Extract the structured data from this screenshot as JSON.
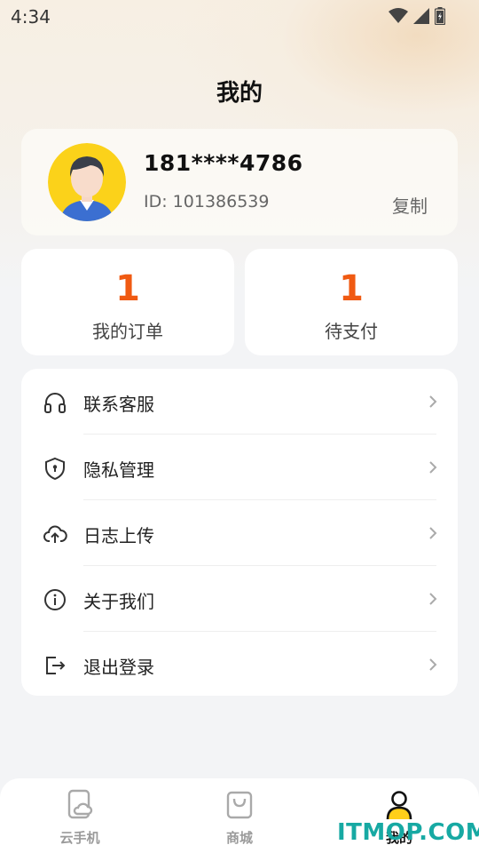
{
  "status_bar": {
    "time": "4:34"
  },
  "page": {
    "title": "我的"
  },
  "profile": {
    "phone": "181****4786",
    "id_text": "ID: 101386539",
    "copy_label": "复制"
  },
  "stats": [
    {
      "value": "1",
      "label": "我的订单"
    },
    {
      "value": "1",
      "label": "待支付"
    }
  ],
  "menu": [
    {
      "icon": "headset-icon",
      "label": "联系客服"
    },
    {
      "icon": "shield-icon",
      "label": "隐私管理"
    },
    {
      "icon": "cloud-upload-icon",
      "label": "日志上传"
    },
    {
      "icon": "info-icon",
      "label": "关于我们"
    },
    {
      "icon": "logout-icon",
      "label": "退出登录"
    }
  ],
  "tabbar": [
    {
      "icon": "cloud-phone-icon",
      "label": "云手机",
      "active": false
    },
    {
      "icon": "shopping-bag-icon",
      "label": "商城",
      "active": false
    },
    {
      "icon": "user-icon",
      "label": "我的",
      "active": true
    }
  ],
  "watermark": "ITMOP.COM",
  "colors": {
    "accent": "#f05a12",
    "active_tab": "#ffcf1a",
    "watermark": "#17a9a3"
  }
}
